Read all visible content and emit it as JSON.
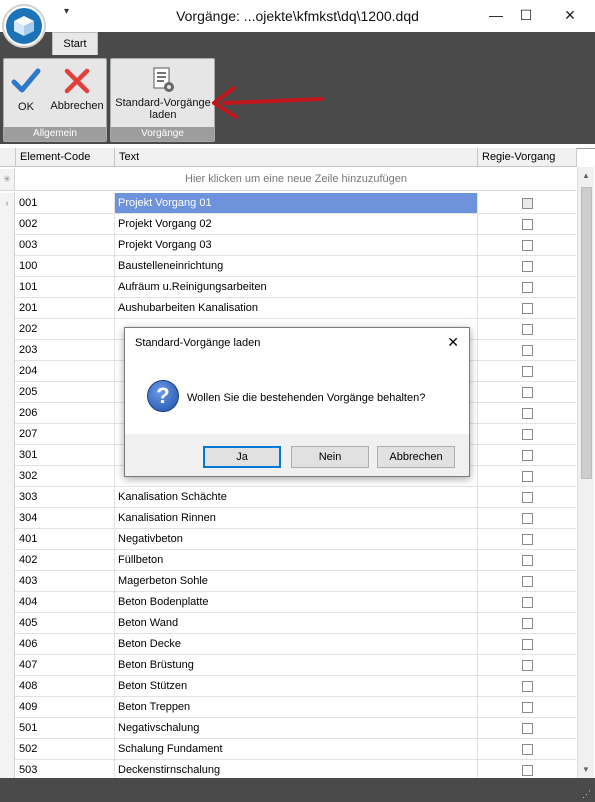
{
  "window": {
    "title": "Vorgänge: ...ojekte\\kfmkst\\dq\\1200.dqd",
    "qat_glyph": "▾",
    "minimize": "—",
    "maximize": "☐",
    "close": "✕"
  },
  "ribbon": {
    "tabs": [
      {
        "label": "Start",
        "active": true
      }
    ],
    "groups": [
      {
        "label": "Allgemein",
        "buttons": [
          {
            "label": "OK",
            "icon": "checkmark-icon"
          },
          {
            "label": "Abbrechen",
            "icon": "cross-icon"
          }
        ]
      },
      {
        "label": "Vorgänge",
        "buttons": [
          {
            "label_line1": "Standard-Vorgänge",
            "label_line2": "laden",
            "icon": "document-gear-icon"
          }
        ]
      }
    ]
  },
  "grid": {
    "columns": [
      "Element-Code",
      "Text",
      "Regie-Vorgang"
    ],
    "new_row_text": "Hier klicken um eine neue Zeile hinzuzufügen",
    "rows": [
      {
        "code": "001",
        "text": "Projekt Vorgang 01",
        "regie": false,
        "selected": true
      },
      {
        "code": "002",
        "text": "Projekt Vorgang 02",
        "regie": false
      },
      {
        "code": "003",
        "text": "Projekt Vorgang 03",
        "regie": false
      },
      {
        "code": "100",
        "text": "Baustelleneinrichtung",
        "regie": false
      },
      {
        "code": "101",
        "text": "Aufräum u.Reinigungsarbeiten",
        "regie": false
      },
      {
        "code": "201",
        "text": "Aushubarbeiten Kanalisation",
        "regie": false
      },
      {
        "code": "202",
        "text": "",
        "regie": false
      },
      {
        "code": "203",
        "text": "",
        "regie": false
      },
      {
        "code": "204",
        "text": "",
        "regie": false
      },
      {
        "code": "205",
        "text": "",
        "regie": false
      },
      {
        "code": "206",
        "text": "",
        "regie": false
      },
      {
        "code": "207",
        "text": "",
        "regie": false
      },
      {
        "code": "301",
        "text": "",
        "regie": false
      },
      {
        "code": "302",
        "text": "",
        "regie": false
      },
      {
        "code": "303",
        "text": "Kanalisation Schächte",
        "regie": false
      },
      {
        "code": "304",
        "text": "Kanalisation Rinnen",
        "regie": false
      },
      {
        "code": "401",
        "text": "Negativbeton",
        "regie": false
      },
      {
        "code": "402",
        "text": "Füllbeton",
        "regie": false
      },
      {
        "code": "403",
        "text": "Magerbeton Sohle",
        "regie": false
      },
      {
        "code": "404",
        "text": "Beton Bodenplatte",
        "regie": false
      },
      {
        "code": "405",
        "text": "Beton Wand",
        "regie": false
      },
      {
        "code": "406",
        "text": "Beton Decke",
        "regie": false
      },
      {
        "code": "407",
        "text": "Beton Brüstung",
        "regie": false
      },
      {
        "code": "408",
        "text": "Beton Stützen",
        "regie": false
      },
      {
        "code": "409",
        "text": "Beton Treppen",
        "regie": false
      },
      {
        "code": "501",
        "text": "Negativschalung",
        "regie": false
      },
      {
        "code": "502",
        "text": "Schalung Fundament",
        "regie": false
      },
      {
        "code": "503",
        "text": "Deckenstirnschalung",
        "regie": false
      }
    ]
  },
  "dialog": {
    "title": "Standard-Vorgänge laden",
    "close": "✕",
    "icon": "question-icon",
    "message": "Wollen Sie die bestehenden Vorgänge behalten?",
    "buttons": {
      "yes": "Ja",
      "no": "Nein",
      "cancel": "Abbrechen"
    }
  },
  "annotation": {
    "arrow_color": "#c0161c"
  },
  "colors": {
    "selection": "#6d93dc",
    "ribbon_dark": "#4a4a4a",
    "app_blue": "#1d73b8"
  }
}
